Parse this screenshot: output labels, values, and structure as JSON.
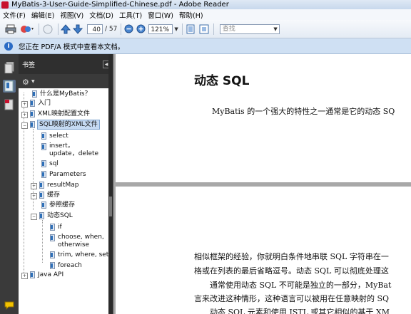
{
  "window": {
    "title": "MyBatis-3-User-Guide-Simplified-Chinese.pdf - Adobe Reader"
  },
  "menu": [
    "文件(F)",
    "编辑(E)",
    "视图(V)",
    "文档(D)",
    "工具(T)",
    "窗口(W)",
    "帮助(H)"
  ],
  "toolbar": {
    "page_current": "40",
    "page_total": "/ 57",
    "zoom": "121%",
    "search_placeholder": "查找"
  },
  "infobar": {
    "text": "您正在 PDF/A 模式中查看本文档。"
  },
  "panel": {
    "title": "书签"
  },
  "bookmarks": [
    {
      "label": "什么是MyBatis？"
    },
    {
      "label": "入门"
    },
    {
      "label": "XML映射配置文件"
    },
    {
      "label": "SQL映射的XML文件"
    },
    {
      "label": "select"
    },
    {
      "label": "insert，update，delete"
    },
    {
      "label": "sql"
    },
    {
      "label": "Parameters"
    },
    {
      "label": "resultMap"
    },
    {
      "label": "缓存"
    },
    {
      "label": "参照缓存"
    },
    {
      "label": "动态SQL"
    },
    {
      "label": "if"
    },
    {
      "label": "choose, when, otherwise"
    },
    {
      "label": "trim, where, set"
    },
    {
      "label": "foreach"
    },
    {
      "label": "Java API"
    }
  ],
  "document": {
    "heading": "动态 SQL",
    "para1": "MyBatis 的一个强大的特性之一通常是它的动态 SQ",
    "page2_lines": [
      "相似框架的经验，你就明白条件地串联 SQL 字符串在一",
      "格或在列表的最后省略逗号。动态 SQL 可以彻底处理这",
      "　　通常使用动态 SQL 不可能是独立的一部分，MyBat",
      "言来改进这种情形，这种语言可以被用在任意映射的 SQ",
      "　　动态 SQL 元素和使用 JSTL 或其它相似的基于 XM"
    ]
  },
  "colors": {
    "accent": "#2a6bc5",
    "panel_dark": "#2f2f2f",
    "infobar": "#cfe0f3"
  }
}
